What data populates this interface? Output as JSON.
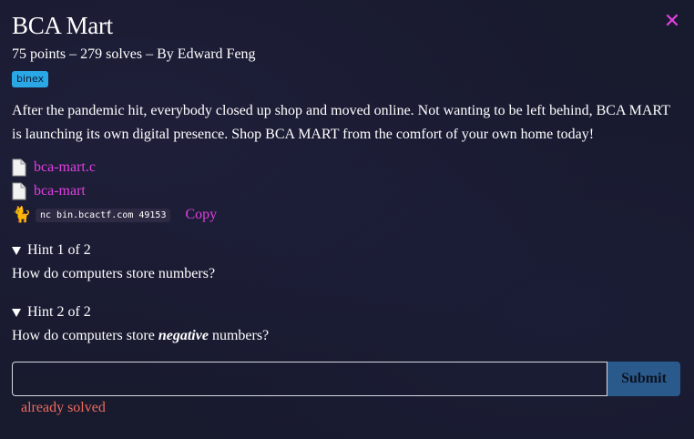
{
  "modal": {
    "title": "BCA Mart",
    "meta": "75 points – 279 solves – By Edward Feng",
    "tag": "binex",
    "close_icon": "close-icon",
    "description": "After the pandemic hit, everybody closed up shop and moved online. Not wanting to be left behind, BCA MART is launching its own digital presence. Shop BCA MART from the comfort of your own home today!"
  },
  "files": [
    {
      "name": "bca-mart.c",
      "icon": "file-icon"
    },
    {
      "name": "bca-mart",
      "icon": "file-icon"
    }
  ],
  "connection": {
    "icon": "cat-icon",
    "command": "nc bin.bcactf.com 49153",
    "copy_label": "Copy"
  },
  "hints": [
    {
      "label": "Hint 1 of 2",
      "text_before": "How do computers store numbers?",
      "emphasis": "",
      "text_after": ""
    },
    {
      "label": "Hint 2 of 2",
      "text_before": "How do computers store ",
      "emphasis": "negative",
      "text_after": " numbers?"
    }
  ],
  "submission": {
    "input_value": "",
    "input_placeholder": "",
    "submit_label": "Submit",
    "status": "already solved"
  },
  "colors": {
    "accent": "#e040e0",
    "tag_bg": "#2aa8e6",
    "submit_bg": "#2a5a8c",
    "status": "#f06a5e",
    "background": "#181a2e"
  }
}
